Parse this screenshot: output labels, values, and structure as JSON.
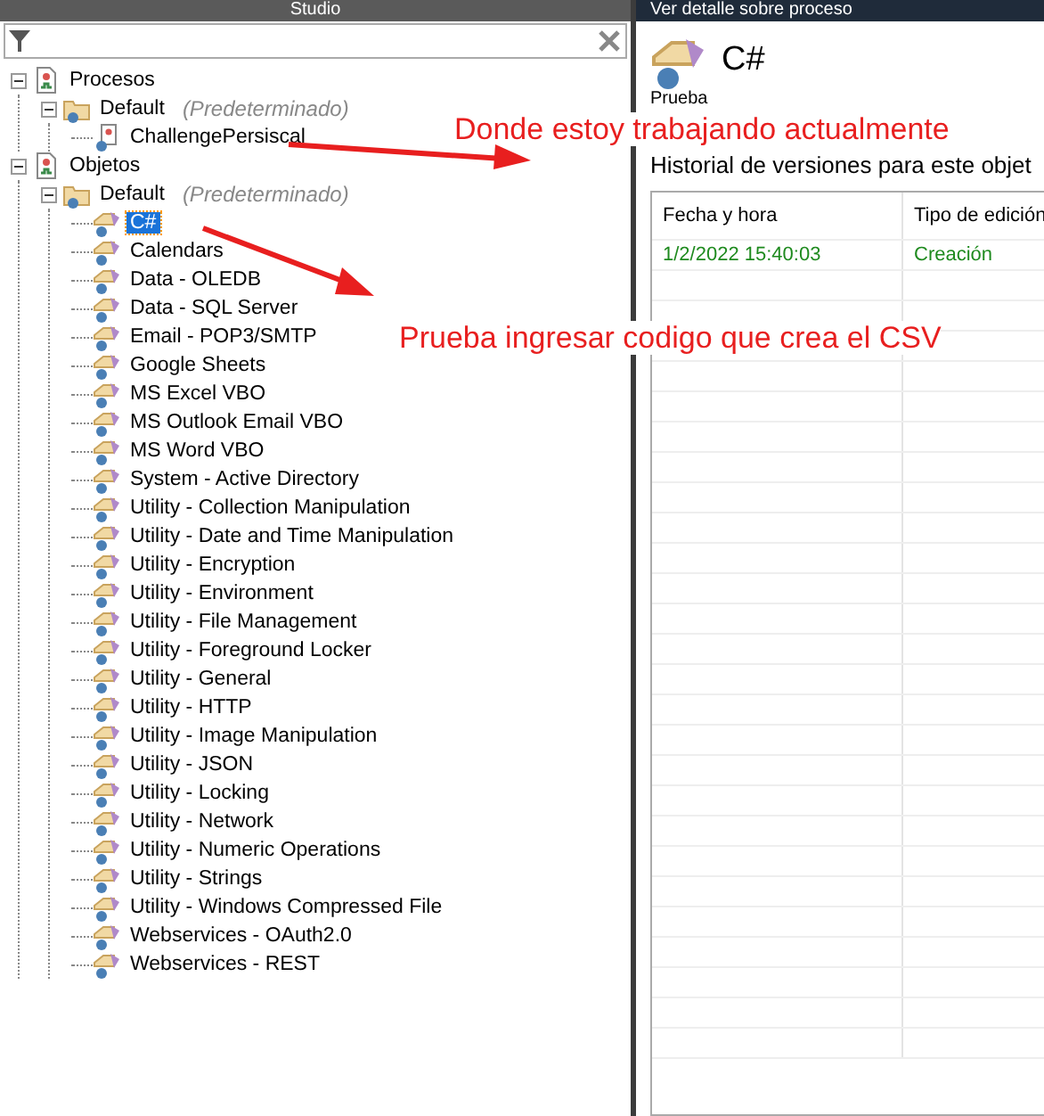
{
  "left_panel": {
    "title": "Studio",
    "tree": [
      {
        "kind": "group",
        "label": "Procesos",
        "expanded": true,
        "selected": false,
        "children": [
          {
            "kind": "folder",
            "label": "Default",
            "note": "(Predeterminado)",
            "expanded": true,
            "selected": false,
            "children": [
              {
                "kind": "process",
                "label": "ChallengePersiscal",
                "selected": false
              }
            ]
          }
        ]
      },
      {
        "kind": "group",
        "label": "Objetos",
        "expanded": true,
        "selected": false,
        "children": [
          {
            "kind": "folder",
            "label": "Default",
            "note": "(Predeterminado)",
            "expanded": true,
            "selected": false,
            "children": [
              {
                "kind": "object",
                "label": "C#",
                "selected": true
              },
              {
                "kind": "object",
                "label": "Calendars",
                "selected": false
              },
              {
                "kind": "object",
                "label": "Data - OLEDB",
                "selected": false
              },
              {
                "kind": "object",
                "label": "Data - SQL Server",
                "selected": false
              },
              {
                "kind": "object",
                "label": "Email - POP3/SMTP",
                "selected": false
              },
              {
                "kind": "object",
                "label": "Google Sheets",
                "selected": false
              },
              {
                "kind": "object",
                "label": "MS Excel VBO",
                "selected": false
              },
              {
                "kind": "object",
                "label": "MS Outlook Email VBO",
                "selected": false
              },
              {
                "kind": "object",
                "label": "MS Word VBO",
                "selected": false
              },
              {
                "kind": "object",
                "label": "System - Active Directory",
                "selected": false
              },
              {
                "kind": "object",
                "label": "Utility - Collection Manipulation",
                "selected": false
              },
              {
                "kind": "object",
                "label": "Utility - Date and Time Manipulation",
                "selected": false
              },
              {
                "kind": "object",
                "label": "Utility - Encryption",
                "selected": false
              },
              {
                "kind": "object",
                "label": "Utility - Environment",
                "selected": false
              },
              {
                "kind": "object",
                "label": "Utility - File Management",
                "selected": false
              },
              {
                "kind": "object",
                "label": "Utility - Foreground Locker",
                "selected": false
              },
              {
                "kind": "object",
                "label": "Utility - General",
                "selected": false
              },
              {
                "kind": "object",
                "label": "Utility - HTTP",
                "selected": false
              },
              {
                "kind": "object",
                "label": "Utility - Image Manipulation",
                "selected": false
              },
              {
                "kind": "object",
                "label": "Utility - JSON",
                "selected": false
              },
              {
                "kind": "object",
                "label": "Utility - Locking",
                "selected": false
              },
              {
                "kind": "object",
                "label": "Utility - Network",
                "selected": false
              },
              {
                "kind": "object",
                "label": "Utility - Numeric Operations",
                "selected": false
              },
              {
                "kind": "object",
                "label": "Utility - Strings",
                "selected": false
              },
              {
                "kind": "object",
                "label": "Utility - Windows Compressed File",
                "selected": false
              },
              {
                "kind": "object",
                "label": "Webservices - OAuth2.0",
                "selected": false
              },
              {
                "kind": "object",
                "label": "Webservices - REST",
                "selected": false
              }
            ]
          }
        ]
      }
    ]
  },
  "right_panel": {
    "title": "Ver detalle sobre proceso",
    "object_name": "C#",
    "subtitle": "Prueba",
    "history_label": "Historial de versiones para este objet",
    "table": {
      "columns": [
        "Fecha y hora",
        "Tipo de edición"
      ],
      "rows": [
        [
          "1/2/2022 15:40:03",
          "Creación"
        ]
      ]
    }
  },
  "annotations": [
    {
      "text": "Donde estoy trabajando actualmente"
    },
    {
      "text": "Prueba ingresar codigo que crea el CSV"
    }
  ]
}
